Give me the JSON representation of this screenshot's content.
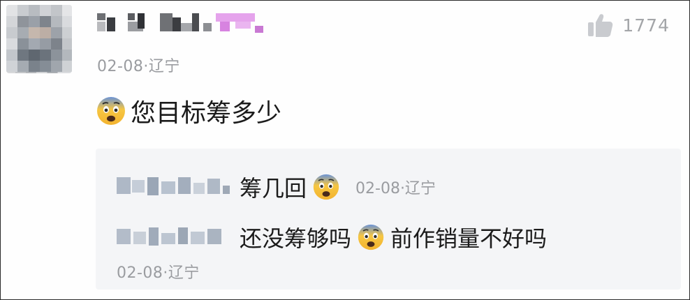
{
  "post": {
    "meta": "02-08·辽宁",
    "comment_text": "您目标筹多少",
    "like_count": "1774"
  },
  "replies": [
    {
      "text": "筹几回",
      "time": "02-08·辽宁"
    },
    {
      "text_before": "还没筹够吗",
      "text_after": "前作销量不好吗",
      "time": "02-08·辽宁"
    }
  ],
  "icons": {
    "like": "thumbs-up-icon",
    "emoji": "fearful-face-emoji"
  },
  "colors": {
    "meta_text": "#9a9ca0",
    "reply_background": "#f4f5f7",
    "username_pink": "#e9a8ef"
  }
}
